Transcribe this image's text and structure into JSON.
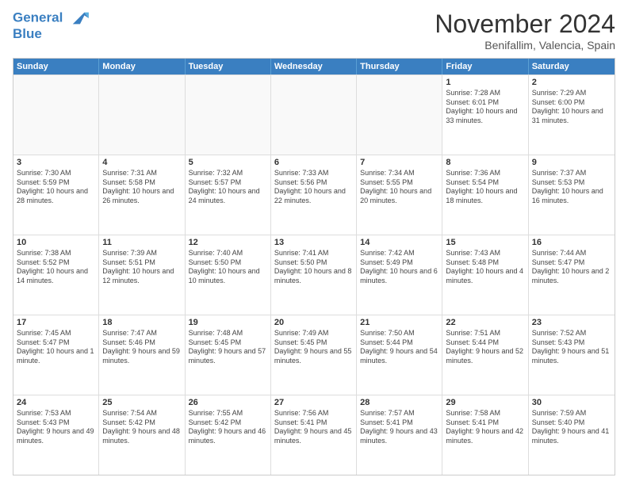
{
  "logo": {
    "line1": "General",
    "line2": "Blue"
  },
  "title": "November 2024",
  "location": "Benifallim, Valencia, Spain",
  "header": {
    "days": [
      "Sunday",
      "Monday",
      "Tuesday",
      "Wednesday",
      "Thursday",
      "Friday",
      "Saturday"
    ]
  },
  "weeks": [
    [
      {
        "day": "",
        "empty": true
      },
      {
        "day": "",
        "empty": true
      },
      {
        "day": "",
        "empty": true
      },
      {
        "day": "",
        "empty": true
      },
      {
        "day": "",
        "empty": true
      },
      {
        "day": "1",
        "sunrise": "Sunrise: 7:28 AM",
        "sunset": "Sunset: 6:01 PM",
        "daylight": "Daylight: 10 hours and 33 minutes."
      },
      {
        "day": "2",
        "sunrise": "Sunrise: 7:29 AM",
        "sunset": "Sunset: 6:00 PM",
        "daylight": "Daylight: 10 hours and 31 minutes."
      }
    ],
    [
      {
        "day": "3",
        "sunrise": "Sunrise: 7:30 AM",
        "sunset": "Sunset: 5:59 PM",
        "daylight": "Daylight: 10 hours and 28 minutes."
      },
      {
        "day": "4",
        "sunrise": "Sunrise: 7:31 AM",
        "sunset": "Sunset: 5:58 PM",
        "daylight": "Daylight: 10 hours and 26 minutes."
      },
      {
        "day": "5",
        "sunrise": "Sunrise: 7:32 AM",
        "sunset": "Sunset: 5:57 PM",
        "daylight": "Daylight: 10 hours and 24 minutes."
      },
      {
        "day": "6",
        "sunrise": "Sunrise: 7:33 AM",
        "sunset": "Sunset: 5:56 PM",
        "daylight": "Daylight: 10 hours and 22 minutes."
      },
      {
        "day": "7",
        "sunrise": "Sunrise: 7:34 AM",
        "sunset": "Sunset: 5:55 PM",
        "daylight": "Daylight: 10 hours and 20 minutes."
      },
      {
        "day": "8",
        "sunrise": "Sunrise: 7:36 AM",
        "sunset": "Sunset: 5:54 PM",
        "daylight": "Daylight: 10 hours and 18 minutes."
      },
      {
        "day": "9",
        "sunrise": "Sunrise: 7:37 AM",
        "sunset": "Sunset: 5:53 PM",
        "daylight": "Daylight: 10 hours and 16 minutes."
      }
    ],
    [
      {
        "day": "10",
        "sunrise": "Sunrise: 7:38 AM",
        "sunset": "Sunset: 5:52 PM",
        "daylight": "Daylight: 10 hours and 14 minutes."
      },
      {
        "day": "11",
        "sunrise": "Sunrise: 7:39 AM",
        "sunset": "Sunset: 5:51 PM",
        "daylight": "Daylight: 10 hours and 12 minutes."
      },
      {
        "day": "12",
        "sunrise": "Sunrise: 7:40 AM",
        "sunset": "Sunset: 5:50 PM",
        "daylight": "Daylight: 10 hours and 10 minutes."
      },
      {
        "day": "13",
        "sunrise": "Sunrise: 7:41 AM",
        "sunset": "Sunset: 5:50 PM",
        "daylight": "Daylight: 10 hours and 8 minutes."
      },
      {
        "day": "14",
        "sunrise": "Sunrise: 7:42 AM",
        "sunset": "Sunset: 5:49 PM",
        "daylight": "Daylight: 10 hours and 6 minutes."
      },
      {
        "day": "15",
        "sunrise": "Sunrise: 7:43 AM",
        "sunset": "Sunset: 5:48 PM",
        "daylight": "Daylight: 10 hours and 4 minutes."
      },
      {
        "day": "16",
        "sunrise": "Sunrise: 7:44 AM",
        "sunset": "Sunset: 5:47 PM",
        "daylight": "Daylight: 10 hours and 2 minutes."
      }
    ],
    [
      {
        "day": "17",
        "sunrise": "Sunrise: 7:45 AM",
        "sunset": "Sunset: 5:47 PM",
        "daylight": "Daylight: 10 hours and 1 minute."
      },
      {
        "day": "18",
        "sunrise": "Sunrise: 7:47 AM",
        "sunset": "Sunset: 5:46 PM",
        "daylight": "Daylight: 9 hours and 59 minutes."
      },
      {
        "day": "19",
        "sunrise": "Sunrise: 7:48 AM",
        "sunset": "Sunset: 5:45 PM",
        "daylight": "Daylight: 9 hours and 57 minutes."
      },
      {
        "day": "20",
        "sunrise": "Sunrise: 7:49 AM",
        "sunset": "Sunset: 5:45 PM",
        "daylight": "Daylight: 9 hours and 55 minutes."
      },
      {
        "day": "21",
        "sunrise": "Sunrise: 7:50 AM",
        "sunset": "Sunset: 5:44 PM",
        "daylight": "Daylight: 9 hours and 54 minutes."
      },
      {
        "day": "22",
        "sunrise": "Sunrise: 7:51 AM",
        "sunset": "Sunset: 5:44 PM",
        "daylight": "Daylight: 9 hours and 52 minutes."
      },
      {
        "day": "23",
        "sunrise": "Sunrise: 7:52 AM",
        "sunset": "Sunset: 5:43 PM",
        "daylight": "Daylight: 9 hours and 51 minutes."
      }
    ],
    [
      {
        "day": "24",
        "sunrise": "Sunrise: 7:53 AM",
        "sunset": "Sunset: 5:43 PM",
        "daylight": "Daylight: 9 hours and 49 minutes."
      },
      {
        "day": "25",
        "sunrise": "Sunrise: 7:54 AM",
        "sunset": "Sunset: 5:42 PM",
        "daylight": "Daylight: 9 hours and 48 minutes."
      },
      {
        "day": "26",
        "sunrise": "Sunrise: 7:55 AM",
        "sunset": "Sunset: 5:42 PM",
        "daylight": "Daylight: 9 hours and 46 minutes."
      },
      {
        "day": "27",
        "sunrise": "Sunrise: 7:56 AM",
        "sunset": "Sunset: 5:41 PM",
        "daylight": "Daylight: 9 hours and 45 minutes."
      },
      {
        "day": "28",
        "sunrise": "Sunrise: 7:57 AM",
        "sunset": "Sunset: 5:41 PM",
        "daylight": "Daylight: 9 hours and 43 minutes."
      },
      {
        "day": "29",
        "sunrise": "Sunrise: 7:58 AM",
        "sunset": "Sunset: 5:41 PM",
        "daylight": "Daylight: 9 hours and 42 minutes."
      },
      {
        "day": "30",
        "sunrise": "Sunrise: 7:59 AM",
        "sunset": "Sunset: 5:40 PM",
        "daylight": "Daylight: 9 hours and 41 minutes."
      }
    ]
  ]
}
